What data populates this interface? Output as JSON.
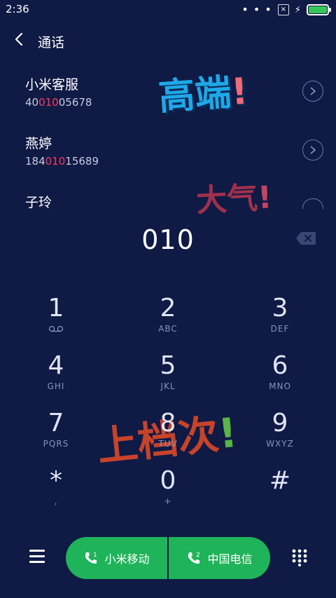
{
  "status_bar": {
    "time": "2:36",
    "more": "• • •",
    "sim_icon": "x-box-icon",
    "battery_color": "#38c65a"
  },
  "header": {
    "title": "通话"
  },
  "contacts": [
    {
      "name": "小米客服",
      "number_pre": "40",
      "number_match": "010",
      "number_post": "05678"
    },
    {
      "name": "燕婷",
      "number_pre": "184",
      "number_match": "010",
      "number_post": "15689"
    },
    {
      "name": "子玲"
    }
  ],
  "stickers": {
    "s1": "高端",
    "s1_mark": "!",
    "s2": "大气",
    "s2_mark": "!",
    "s3": "上档次",
    "s3_mark": "!"
  },
  "dialer": {
    "input": "010"
  },
  "keys": [
    {
      "digit": "1",
      "letters": ""
    },
    {
      "digit": "2",
      "letters": "ABC"
    },
    {
      "digit": "3",
      "letters": "DEF"
    },
    {
      "digit": "4",
      "letters": "GHI"
    },
    {
      "digit": "5",
      "letters": "JKL"
    },
    {
      "digit": "6",
      "letters": "MNO"
    },
    {
      "digit": "7",
      "letters": "PQRS"
    },
    {
      "digit": "8",
      "letters": "TUV"
    },
    {
      "digit": "9",
      "letters": "WXYZ"
    },
    {
      "digit": "*",
      "letters": ","
    },
    {
      "digit": "0",
      "letters": "+"
    },
    {
      "digit": "#",
      "letters": ""
    }
  ],
  "call_buttons": {
    "sim1_label": "小米移动",
    "sim2_label": "中国电信",
    "sim1_badge": "1",
    "sim2_badge": "2"
  },
  "colors": {
    "background": "#0f1a45",
    "accent_green": "#1fb35a",
    "highlight_red": "#ff3b5c"
  }
}
